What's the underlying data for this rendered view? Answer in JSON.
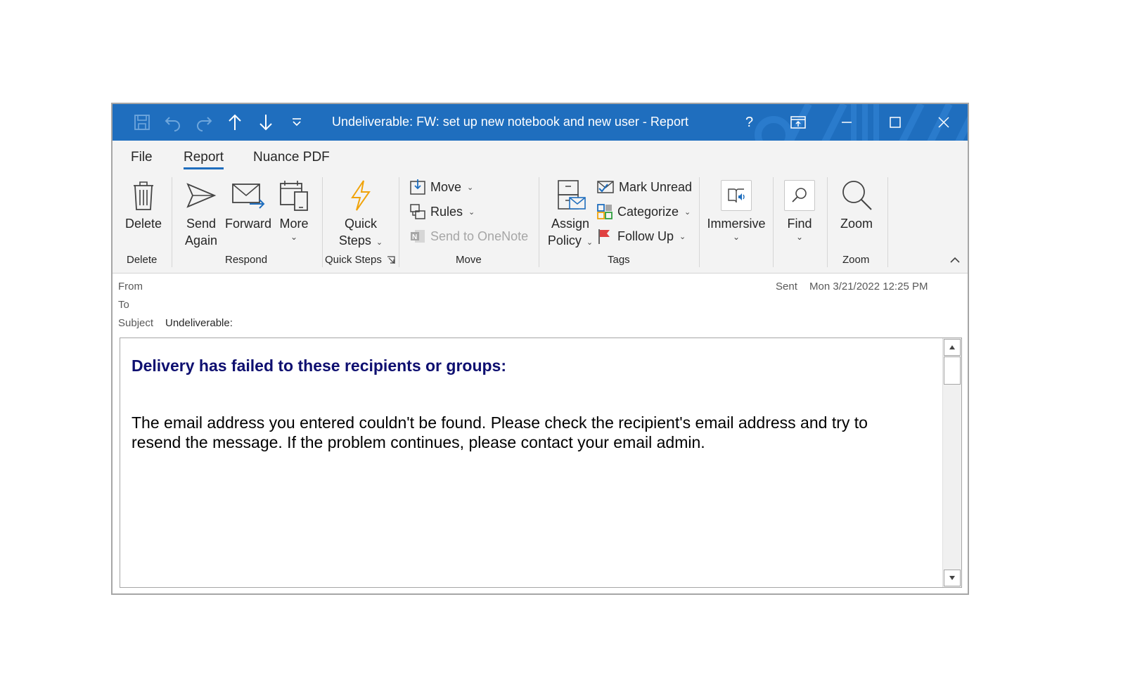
{
  "window": {
    "title": "Undeliverable: FW: set up new notebook and new user  -  Report",
    "help": "?"
  },
  "quick_access": {
    "icons": [
      "save-icon",
      "undo-icon",
      "redo-icon",
      "arrow-up-icon",
      "arrow-down-icon",
      "customize-icon"
    ]
  },
  "ribbon_tabs": [
    {
      "label": "File"
    },
    {
      "label": "Report",
      "active": true
    },
    {
      "label": "Nuance PDF"
    }
  ],
  "ribbon": {
    "delete": {
      "label": "Delete",
      "group": "Delete"
    },
    "respond": {
      "send_again_l1": "Send",
      "send_again_l2": "Again",
      "forward": "Forward",
      "more": "More",
      "group": "Respond"
    },
    "quick_steps": {
      "l1": "Quick",
      "l2": "Steps",
      "group": "Quick Steps"
    },
    "move": {
      "move": "Move",
      "rules": "Rules",
      "onenote": "Send to OneNote",
      "group": "Move"
    },
    "tags": {
      "assign_l1": "Assign",
      "assign_l2": "Policy",
      "mark_unread": "Mark Unread",
      "categorize": "Categorize",
      "follow_up": "Follow Up",
      "group": "Tags"
    },
    "immersive": {
      "label": "Immersive"
    },
    "find": {
      "label": "Find"
    },
    "zoom": {
      "label": "Zoom",
      "group": "Zoom"
    }
  },
  "headers": {
    "from_label": "From",
    "to_label": "To",
    "subject_label": "Subject",
    "subject_value": "Undeliverable:",
    "sent_label": "Sent",
    "sent_value": "Mon 3/21/2022 12:25 PM"
  },
  "message": {
    "heading": "Delivery has failed to these recipients or groups:",
    "text": "The email address you entered couldn't be found. Please check the recipient's email address and try to resend the message. If the problem continues, please contact your email admin."
  },
  "colors": {
    "accent": "#1f6ebe",
    "heading": "#0e0f70",
    "ribbon_bg": "#f3f3f3"
  }
}
